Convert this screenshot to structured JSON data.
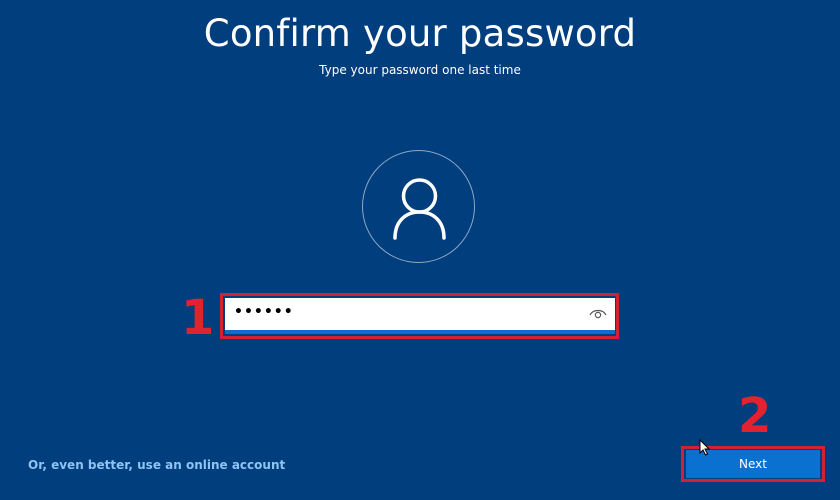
{
  "page": {
    "title": "Confirm your password",
    "subtitle": "Type your password one last time"
  },
  "avatar": {
    "icon": "user-icon"
  },
  "password": {
    "value": "••••••",
    "reveal_icon": "eye-icon"
  },
  "annotations": {
    "step1": "1",
    "step2": "2",
    "highlight_color": "#cf2233"
  },
  "footer": {
    "online_account_link": "Or, even better, use an online account",
    "next_label": "Next"
  },
  "colors": {
    "background": "#003e7e",
    "accent": "#0a71d0",
    "link": "#8fc3f2"
  }
}
